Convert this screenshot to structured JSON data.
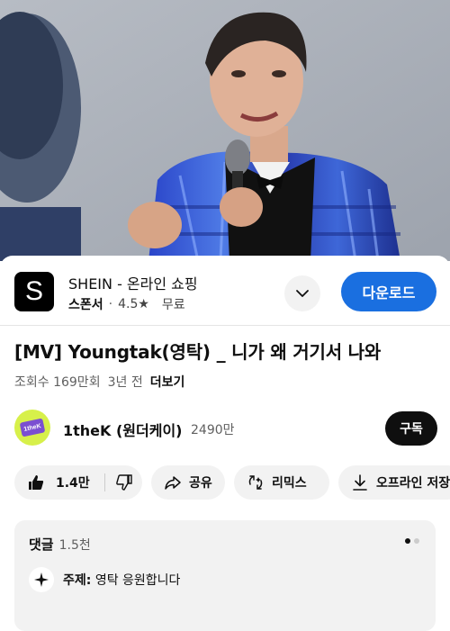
{
  "ad": {
    "logo_letter": "S",
    "title": "SHEIN - 온라인 쇼핑",
    "sponsor_label": "스폰서",
    "separator": "·",
    "rating": "4.5★",
    "price": "무료",
    "download_label": "다운로드"
  },
  "video": {
    "title": "[MV] Youngtak(영탁) _ 니가 왜 거기서 나와",
    "views": "조회수 169만회",
    "age": "3년 전",
    "more_label": "더보기"
  },
  "channel": {
    "avatar_text": "1theK",
    "name": "1theK (원더케이)",
    "subscribers": "2490만",
    "subscribe_label": "구독"
  },
  "actions": {
    "like_count": "1.4만",
    "share_label": "공유",
    "remix_label": "리믹스",
    "offline_label": "오프라인 저장"
  },
  "comments": {
    "heading": "댓글",
    "count": "1.5천",
    "topic_prefix": "주제:",
    "topic_text": "영탁 응원합니다"
  },
  "icons": {
    "expand": "chevron-down-icon",
    "like": "thumbs-up-icon",
    "dislike": "thumbs-down-icon",
    "share": "share-icon",
    "remix": "remix-icon",
    "offline": "download-icon",
    "topic": "sparkle-icon"
  },
  "colors": {
    "download_button": "#1a6fe0",
    "subscribe_button": "#0f0f0f",
    "pill_bg": "#f2f2f2"
  }
}
